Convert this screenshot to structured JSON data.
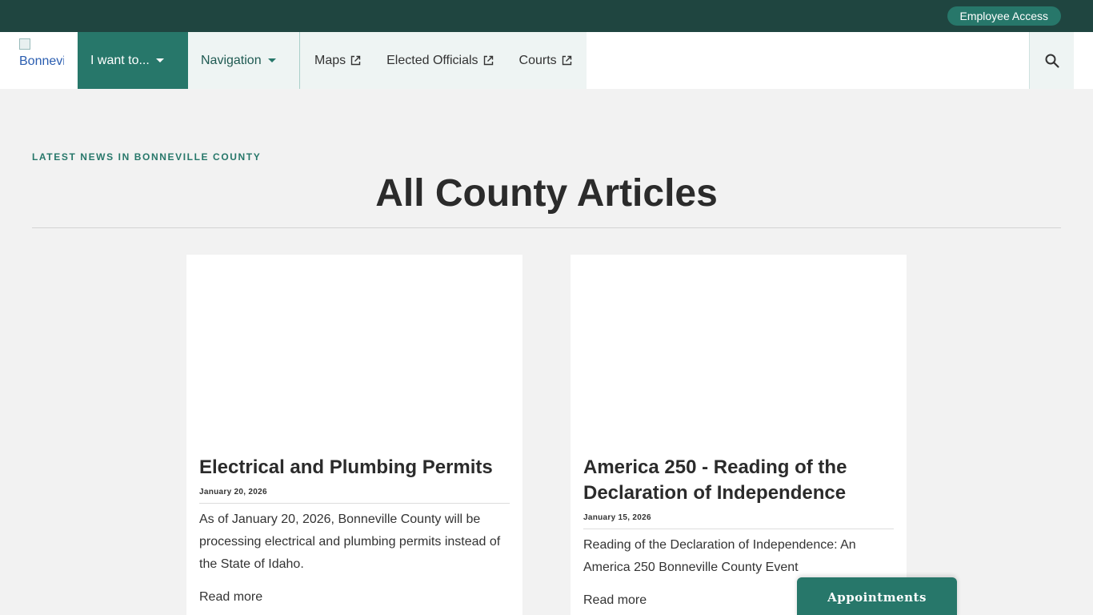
{
  "topbar": {
    "employee_access_label": "Employee Access"
  },
  "logo": {
    "alt_text": "Bonneville County"
  },
  "nav": {
    "want_to_label": "I want to...",
    "navigation_label": "Navigation",
    "links": [
      {
        "label": "Maps",
        "icon": "external-link-icon"
      },
      {
        "label": "Elected Officials",
        "icon": "external-link-icon"
      },
      {
        "label": "Courts",
        "icon": "external-link-icon"
      }
    ],
    "search_icon": "search-icon"
  },
  "header": {
    "eyebrow": "LATEST NEWS IN BONNEVILLE COUNTY",
    "title": "All County Articles"
  },
  "articles": [
    {
      "title": "Electrical and Plumbing Permits",
      "date": "January 20, 2026",
      "summary": "As of January 20, 2026, Bonneville County will be processing electrical and plumbing permits instead of the State of Idaho.",
      "read_more": "Read more"
    },
    {
      "title": "America 250 - Reading of the Declaration of Independence",
      "date": "January 15, 2026",
      "summary": "Reading of the Declaration of Independence: An America 250 Bonneville County Event",
      "read_more": "Read more"
    }
  ],
  "appointments_label": "Appointments",
  "colors": {
    "topbar": "#1f4540",
    "accent": "#27776a",
    "nav_light": "#eef4f3",
    "page_bg": "#f2f2f2"
  }
}
